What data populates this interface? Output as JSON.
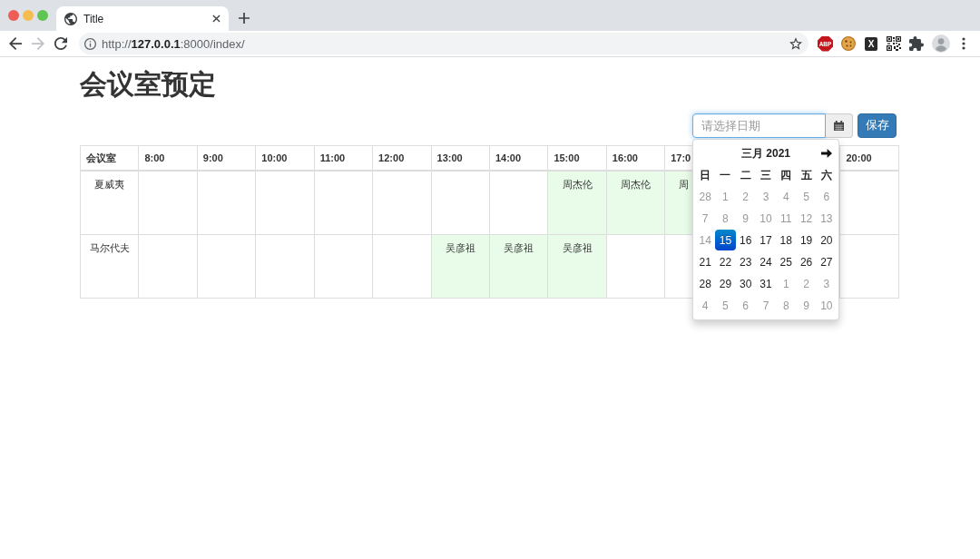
{
  "browser": {
    "window_controls": [
      {
        "color": "#ee5e56"
      },
      {
        "color": "#f5bd4f"
      },
      {
        "color": "#5fc553"
      }
    ],
    "tabs": [
      {
        "title": "Title",
        "selected": true
      }
    ],
    "nav_buttons": [
      {
        "kind": "back",
        "disabled": false
      },
      {
        "kind": "forward",
        "disabled": true
      },
      {
        "kind": "reload",
        "disabled": false
      }
    ],
    "address": "http://**127.0.0.1**:8000/index/",
    "toolbar_icons": [
      {
        "kind": "badge",
        "label": "ABP"
      },
      {
        "kind": "cookie"
      },
      {
        "kind": "tile",
        "label": "X"
      },
      {
        "kind": "qr"
      },
      {
        "kind": "puzzle"
      },
      {
        "kind": "avatar"
      },
      {
        "kind": "menu"
      }
    ]
  },
  "page": {
    "heading": "会议室预定",
    "date_field": {
      "placeholder": "请选择日期",
      "focused": true
    },
    "save_button": "保存",
    "datepicker": {
      "title": "三月 2021",
      "weekdays": [
        "日",
        "一",
        "二",
        "三",
        "四",
        "五",
        "六"
      ],
      "days": [
        {
          "label": "28",
          "disabled": true,
          "selected": false
        },
        {
          "label": "1",
          "disabled": true,
          "selected": false
        },
        {
          "label": "2",
          "disabled": true,
          "selected": false
        },
        {
          "label": "3",
          "disabled": true,
          "selected": false
        },
        {
          "label": "4",
          "disabled": true,
          "selected": false
        },
        {
          "label": "5",
          "disabled": true,
          "selected": false
        },
        {
          "label": "6",
          "disabled": true,
          "selected": false
        },
        {
          "label": "7",
          "disabled": true,
          "selected": false
        },
        {
          "label": "8",
          "disabled": true,
          "selected": false
        },
        {
          "label": "9",
          "disabled": true,
          "selected": false
        },
        {
          "label": "10",
          "disabled": true,
          "selected": false
        },
        {
          "label": "11",
          "disabled": true,
          "selected": false
        },
        {
          "label": "12",
          "disabled": true,
          "selected": false
        },
        {
          "label": "13",
          "disabled": true,
          "selected": false
        },
        {
          "label": "14",
          "disabled": true,
          "selected": false
        },
        {
          "label": "15",
          "disabled": false,
          "selected": true
        },
        {
          "label": "16",
          "disabled": false,
          "selected": false
        },
        {
          "label": "17",
          "disabled": false,
          "selected": false
        },
        {
          "label": "18",
          "disabled": false,
          "selected": false
        },
        {
          "label": "19",
          "disabled": false,
          "selected": false
        },
        {
          "label": "20",
          "disabled": false,
          "selected": false
        },
        {
          "label": "21",
          "disabled": false,
          "selected": false
        },
        {
          "label": "22",
          "disabled": false,
          "selected": false
        },
        {
          "label": "23",
          "disabled": false,
          "selected": false
        },
        {
          "label": "24",
          "disabled": false,
          "selected": false
        },
        {
          "label": "25",
          "disabled": false,
          "selected": false
        },
        {
          "label": "26",
          "disabled": false,
          "selected": false
        },
        {
          "label": "27",
          "disabled": false,
          "selected": false
        },
        {
          "label": "28",
          "disabled": false,
          "selected": false
        },
        {
          "label": "29",
          "disabled": false,
          "selected": false
        },
        {
          "label": "30",
          "disabled": false,
          "selected": false
        },
        {
          "label": "31",
          "disabled": false,
          "selected": false
        },
        {
          "label": "1",
          "disabled": true,
          "selected": false
        },
        {
          "label": "2",
          "disabled": true,
          "selected": false
        },
        {
          "label": "3",
          "disabled": true,
          "selected": false
        },
        {
          "label": "4",
          "disabled": true,
          "selected": false
        },
        {
          "label": "5",
          "disabled": true,
          "selected": false
        },
        {
          "label": "6",
          "disabled": true,
          "selected": false
        },
        {
          "label": "7",
          "disabled": true,
          "selected": false
        },
        {
          "label": "8",
          "disabled": true,
          "selected": false
        },
        {
          "label": "9",
          "disabled": true,
          "selected": false
        },
        {
          "label": "10",
          "disabled": true,
          "selected": false
        }
      ]
    },
    "table": {
      "columns": [
        {
          "label": "会议室"
        },
        {
          "label": "8:00"
        },
        {
          "label": "9:00"
        },
        {
          "label": "10:00"
        },
        {
          "label": "11:00"
        },
        {
          "label": "12:00"
        },
        {
          "label": "13:00"
        },
        {
          "label": "14:00"
        },
        {
          "label": "15:00"
        },
        {
          "label": "16:00"
        },
        {
          "label": "17:0"
        },
        {},
        {},
        {
          "label": "20:00"
        }
      ],
      "rows": [
        {
          "cells": [
            {
              "kind": "room",
              "text": "夏威夷"
            },
            {
              "kind": "slot",
              "booked": false
            },
            {
              "kind": "slot",
              "booked": false
            },
            {
              "kind": "slot",
              "booked": false
            },
            {
              "kind": "slot",
              "booked": false
            },
            {
              "kind": "slot",
              "booked": false
            },
            {
              "kind": "slot",
              "booked": false
            },
            {
              "kind": "slot",
              "booked": false
            },
            {
              "kind": "slot",
              "booked": true,
              "text": "周杰伦"
            },
            {
              "kind": "slot",
              "booked": true,
              "text": "周杰伦"
            },
            {
              "kind": "slot",
              "booked": true,
              "text": "周"
            },
            {},
            {},
            {
              "kind": "slot",
              "booked": false
            }
          ]
        },
        {
          "cells": [
            {
              "kind": "room",
              "text": "马尔代夫"
            },
            {
              "kind": "slot",
              "booked": false
            },
            {
              "kind": "slot",
              "booked": false
            },
            {
              "kind": "slot",
              "booked": false
            },
            {
              "kind": "slot",
              "booked": false
            },
            {
              "kind": "slot",
              "booked": false
            },
            {
              "kind": "slot",
              "booked": true,
              "text": "吴彦祖"
            },
            {
              "kind": "slot",
              "booked": true,
              "text": "吴彦祖"
            },
            {
              "kind": "slot",
              "booked": true,
              "text": "吴彦祖"
            },
            {
              "kind": "slot",
              "booked": false
            },
            {
              "kind": "slot",
              "booked": false
            },
            {},
            {},
            {
              "kind": "slot",
              "booked": false
            }
          ]
        }
      ]
    }
  }
}
